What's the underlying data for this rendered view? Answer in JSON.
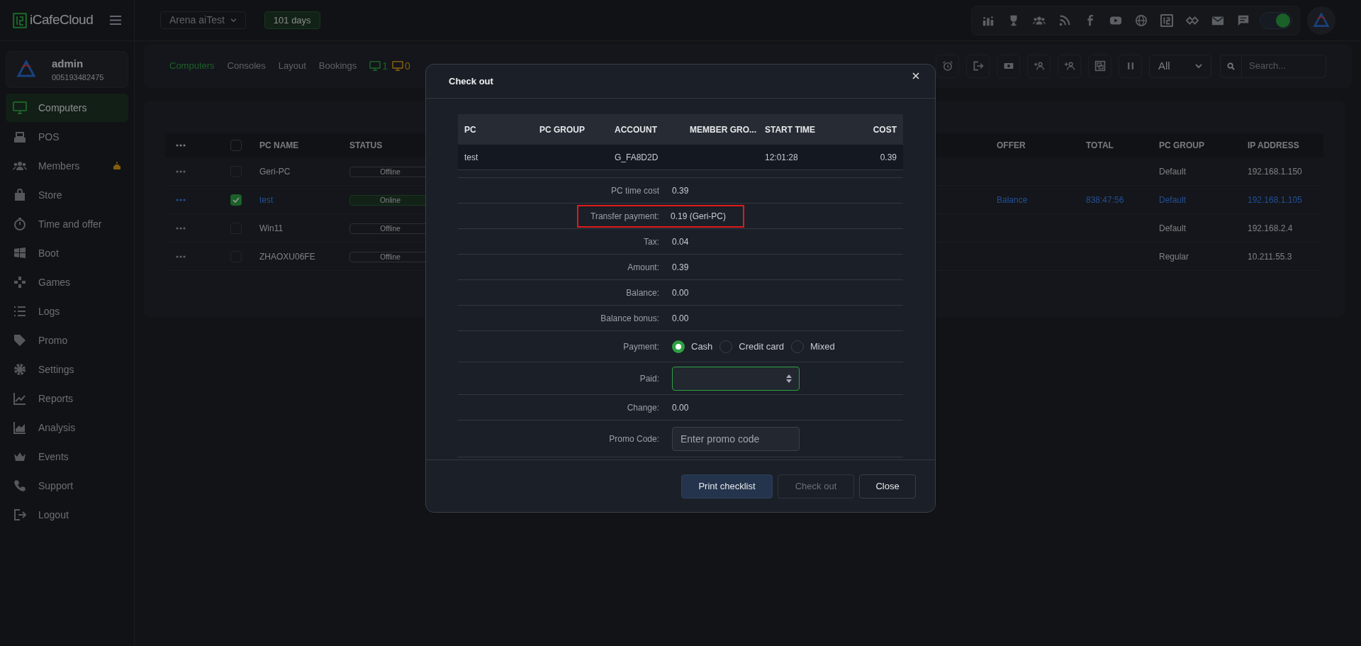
{
  "app": {
    "logo": "iCafeCloud"
  },
  "topbar": {
    "store": "Arena aiTest",
    "license": "101 days",
    "theme_toggle": {
      "on": true
    }
  },
  "sidebar": {
    "user": {
      "name": "admin",
      "id": "005193482475"
    },
    "items": [
      {
        "label": "Computers",
        "selected": true,
        "alert": false
      },
      {
        "label": "POS",
        "selected": false,
        "alert": false
      },
      {
        "label": "Members",
        "selected": false,
        "alert": true
      },
      {
        "label": "Store",
        "selected": false,
        "alert": false
      },
      {
        "label": "Time and offer",
        "selected": false,
        "alert": false
      },
      {
        "label": "Boot",
        "selected": false,
        "alert": false
      },
      {
        "label": "Games",
        "selected": false,
        "alert": false
      },
      {
        "label": "Logs",
        "selected": false,
        "alert": false
      },
      {
        "label": "Promo",
        "selected": false,
        "alert": false
      },
      {
        "label": "Settings",
        "selected": false,
        "alert": false
      },
      {
        "label": "Reports",
        "selected": false,
        "alert": false
      },
      {
        "label": "Analysis",
        "selected": false,
        "alert": false
      },
      {
        "label": "Events",
        "selected": false,
        "alert": false
      },
      {
        "label": "Support",
        "selected": false,
        "alert": false
      },
      {
        "label": "Logout",
        "selected": false,
        "alert": false
      }
    ]
  },
  "toolbar": {
    "tabs": [
      {
        "label": "Computers",
        "selected": true
      },
      {
        "label": "Consoles",
        "selected": false
      },
      {
        "label": "Layout",
        "selected": false
      },
      {
        "label": "Bookings",
        "selected": false
      }
    ],
    "counts": [
      {
        "kind": "online",
        "value": "1"
      },
      {
        "kind": "busy",
        "value": "0"
      }
    ],
    "filter": "All",
    "search": {
      "placeholder": "Search..."
    }
  },
  "table": {
    "select_all": {
      "checked": false
    },
    "columns": [
      "PC NAME",
      "STATUS",
      "OFFER",
      "TOTAL",
      "PC GROUP",
      "IP ADDRESS"
    ],
    "rows": [
      {
        "pc_name": "Geri-PC",
        "status": "Offline",
        "online": false,
        "selected": false,
        "pc_group": "Default",
        "ip_address": "192.168.1.150"
      },
      {
        "pc_name": "test",
        "status": "Online",
        "online": true,
        "selected": true,
        "offer": "Balance",
        "total": "838:47:56",
        "pc_group": "Default",
        "ip_address": "192.168.1.105"
      },
      {
        "pc_name": "Win11",
        "status": "Offline",
        "online": false,
        "selected": false,
        "pc_group": "Default",
        "ip_address": "192.168.2.4"
      },
      {
        "pc_name": "ZHAOXU06FE",
        "status": "Offline",
        "online": false,
        "selected": false,
        "pc_group": "Regular",
        "ip_address": "10.211.55.3"
      }
    ]
  },
  "dialog": {
    "title": "Check out",
    "table": {
      "columns": [
        "PC",
        "PC GROUP",
        "ACCOUNT",
        "MEMBER GRO...",
        "START TIME",
        "COST"
      ],
      "rows": [
        {
          "pc": "test",
          "account": "G_FA8D2D",
          "start_time": "12:01:28",
          "cost": "0.39"
        }
      ]
    },
    "fields": [
      {
        "kind": "text",
        "label": "PC time cost",
        "value": "0.39",
        "highlighted": false
      },
      {
        "kind": "text",
        "label": "Transfer payment:",
        "value": "0.19 (Geri-PC)",
        "highlighted": true
      },
      {
        "kind": "text",
        "label": "Tax:",
        "value": "0.04",
        "highlighted": false
      },
      {
        "kind": "text",
        "label": "Amount:",
        "value": "0.39",
        "highlighted": false
      },
      {
        "kind": "text",
        "label": "Balance:",
        "value": "0.00",
        "highlighted": false
      },
      {
        "kind": "text",
        "label": "Balance bonus:",
        "value": "0.00",
        "highlighted": false
      },
      {
        "kind": "radio",
        "label": "Payment:",
        "options": [
          {
            "label": "Cash",
            "selected": true
          },
          {
            "label": "Credit card",
            "selected": false
          },
          {
            "label": "Mixed",
            "selected": false
          }
        ]
      },
      {
        "kind": "number",
        "label": "Paid:",
        "focused": true
      },
      {
        "kind": "text",
        "label": "Change:",
        "value": "0.00",
        "highlighted": false
      },
      {
        "kind": "input",
        "label": "Promo Code:",
        "placeholder": "Enter promo code"
      }
    ],
    "buttons": [
      {
        "label": "Print checklist",
        "kind": "primary",
        "disabled": false
      },
      {
        "label": "Check out",
        "kind": "default",
        "disabled": true
      },
      {
        "label": "Close",
        "kind": "default",
        "disabled": false
      }
    ]
  }
}
